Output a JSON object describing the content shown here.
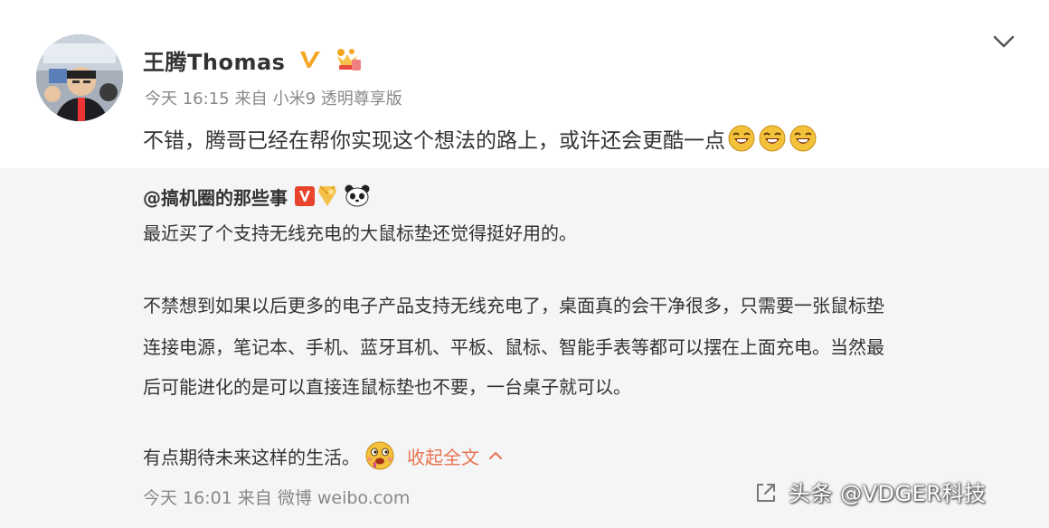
{
  "post": {
    "username": "王腾Thomas",
    "time": "今天 16:15",
    "source_prefix": "来自",
    "source": "小米9 透明尊享版",
    "text": "不错，腾哥已经在帮你实现这个想法的路上，或许还会更酷一点"
  },
  "repost": {
    "user": "@搞机圈的那些事",
    "line1": "最近买了个支持无线充电的大鼠标垫还觉得挺好用的。",
    "line2": "不禁想到如果以后更多的电子产品支持无线充电了，桌面真的会干净很多，只需要一张鼠标垫",
    "line3": "连接电源，笔记本、手机、蓝牙耳机、平板、鼠标、智能手表等都可以摆在上面充电。当然最",
    "line4": "后可能进化的是可以直接连鼠标垫也不要，一台桌子就可以。",
    "line5": "有点期待未来这样的生活。",
    "collapse_label": "收起全文",
    "time": "今天 16:01",
    "source_prefix": "来自",
    "source": "微博 weibo.com"
  },
  "watermark": "头条 @VDGER科技",
  "icons": {
    "chevron": "chevron-down-icon",
    "verified": "verified-v-icon",
    "laugh": "laugh-emoji-icon",
    "drool": "drool-emoji-icon",
    "share": "share-icon"
  },
  "colors": {
    "accent_link": "#eb7350",
    "verified": "#f5a623",
    "meta_text": "#888888"
  }
}
